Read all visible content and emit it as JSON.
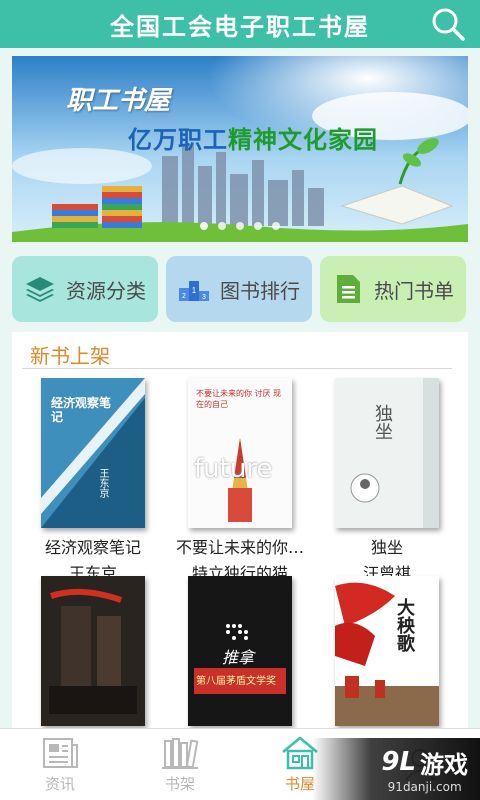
{
  "header": {
    "title": "全国工会电子职工书屋",
    "search_icon": "search-icon"
  },
  "banner": {
    "line1": "职工书屋",
    "line2_blue": "亿万职工",
    "line2_green": "精神文化家园",
    "dots": 5,
    "active_dot": 0
  },
  "categories": [
    {
      "label": "资源分类",
      "icon": "layers-icon",
      "bg": "#a8e5dc"
    },
    {
      "label": "图书排行",
      "icon": "podium-icon",
      "bg": "#b5d8ef"
    },
    {
      "label": "热门书单",
      "icon": "document-icon",
      "bg": "#c9efb5"
    }
  ],
  "section": {
    "title": "新书上架"
  },
  "books": [
    {
      "title": "经济观察笔记",
      "author": "王东京",
      "cover_title": "经济观察笔记",
      "cover_author": "王东京"
    },
    {
      "title": "不要让未来的你…",
      "author": "特立独行的猫",
      "cover_title": "不要让未来的你 讨厌 现在的自己",
      "cover_word": "future"
    },
    {
      "title": "独坐",
      "author": "汪曾祺",
      "cover_title": "独坐"
    },
    {
      "title": "",
      "author": "",
      "cover_title": ""
    },
    {
      "title": "",
      "author": "",
      "cover_title": "推拿",
      "cover_award": "第八届茅盾文学奖"
    },
    {
      "title": "",
      "author": "",
      "cover_title": "大秧歌"
    }
  ],
  "nav": {
    "items": [
      {
        "label": "资讯",
        "icon": "news-icon",
        "active": false
      },
      {
        "label": "书架",
        "icon": "bookshelf-icon",
        "active": false
      },
      {
        "label": "书屋",
        "icon": "house-icon",
        "active": true
      },
      {
        "label": "",
        "icon": "user-icon",
        "active": false
      }
    ],
    "active_color": "#e38b2e",
    "inactive_color": "#b8b8b8"
  },
  "watermark": {
    "logo": "9L",
    "text": "游戏",
    "url": "91danji.com"
  },
  "colors": {
    "header": "#3dbfa8",
    "section_title": "#e0882a"
  }
}
